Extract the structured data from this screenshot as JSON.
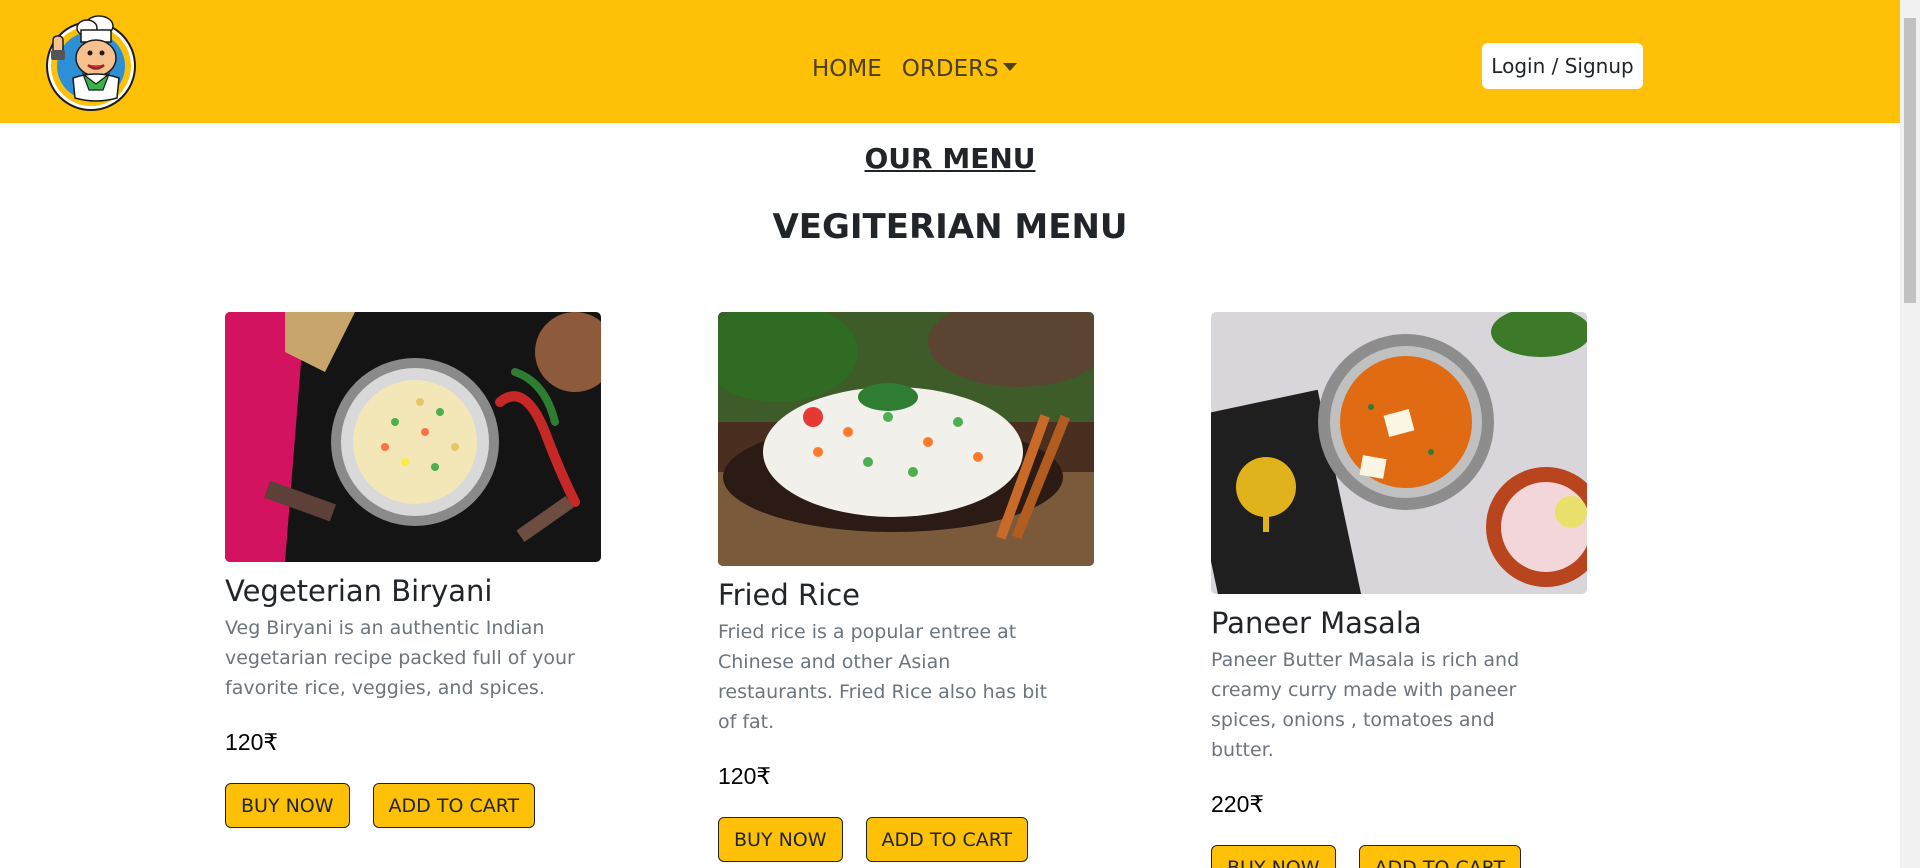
{
  "navbar": {
    "logo_alt": "chef-logo",
    "links": [
      {
        "label": "HOME"
      },
      {
        "label": "ORDERS"
      }
    ],
    "login_label": "Login / Signup"
  },
  "page": {
    "title": "OUR MENU",
    "section_title": "VEGITERIAN MENU"
  },
  "cards": [
    {
      "title": "Vegeterian Biryani",
      "description": "Veg Biryani is an authentic Indian vegetarian recipe packed full of your favorite rice, veggies, and spices.",
      "price": "120₹",
      "buy_label": "BUY NOW",
      "cart_label": "ADD TO CART"
    },
    {
      "title": "Fried Rice",
      "description": "Fried rice is a popular entree at Chinese and other Asian restaurants. Fried Rice also has bit of fat.",
      "price": "120₹",
      "buy_label": "BUY NOW",
      "cart_label": "ADD TO CART"
    },
    {
      "title": "Paneer Masala",
      "description": "Paneer Butter Masala is rich and creamy curry made with paneer spices, onions , tomatoes and butter.",
      "price": "220₹",
      "buy_label": "BUY NOW",
      "cart_label": "ADD TO CART"
    }
  ],
  "colors": {
    "navbar_bg": "#ffc107",
    "button_bg": "#ffc107",
    "text_dark": "#212529",
    "text_muted": "#6c757d"
  }
}
